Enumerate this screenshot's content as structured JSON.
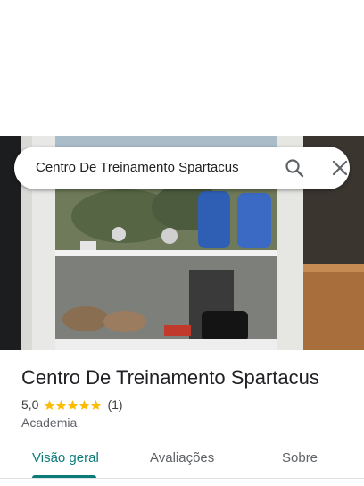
{
  "search": {
    "query": "Centro De Treinamento Spartacus",
    "search_icon": "search-icon",
    "close_icon": "close-icon"
  },
  "photo": {
    "description_icon": "storefront-photo"
  },
  "place": {
    "name": "Centro De Treinamento Spartacus",
    "rating": "5,0",
    "stars": 5,
    "reviews": "(1)",
    "category": "Academia"
  },
  "colors": {
    "accent": "#0b7b7a",
    "star": "#fbbc04"
  },
  "tabs": [
    {
      "label": "Visão geral",
      "active": true
    },
    {
      "label": "Avaliações",
      "active": false
    },
    {
      "label": "Sobre",
      "active": false
    }
  ]
}
